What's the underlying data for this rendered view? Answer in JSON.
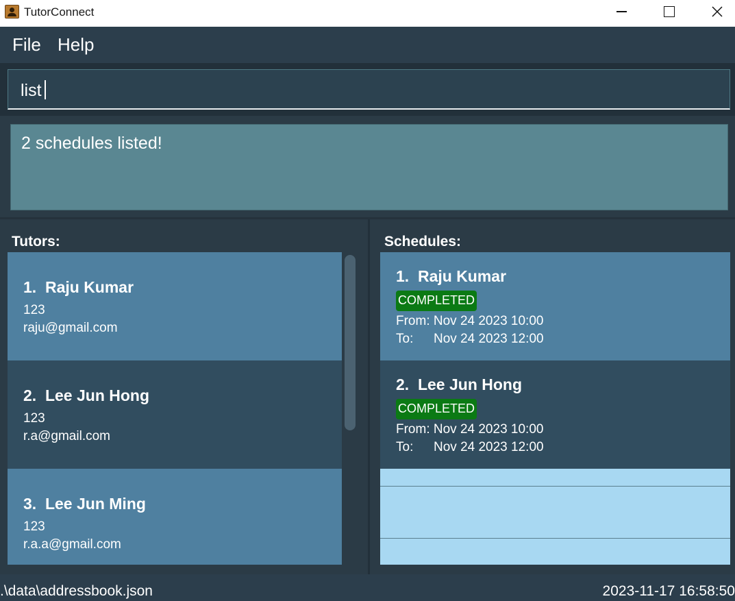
{
  "window": {
    "title": "TutorConnect",
    "icon": "contact-book-icon"
  },
  "menu": {
    "items": [
      "File",
      "Help"
    ]
  },
  "command": {
    "value": "list"
  },
  "result": {
    "message": "2 schedules listed!"
  },
  "tutors": {
    "heading": "Tutors:",
    "items": [
      {
        "index": "1.",
        "name": "Raju Kumar",
        "phone": "123",
        "email": "raju@gmail.com"
      },
      {
        "index": "2.",
        "name": "Lee Jun Hong",
        "phone": "123",
        "email": "r.a@gmail.com"
      },
      {
        "index": "3.",
        "name": "Lee Jun Ming",
        "phone": "123",
        "email": "r.a.a@gmail.com"
      }
    ]
  },
  "schedules": {
    "heading": "Schedules:",
    "items": [
      {
        "index": "1.",
        "name": "Raju Kumar",
        "status": "COMPLETED",
        "from_label": "From:",
        "from": "Nov 24 2023 10:00",
        "to_label": "To:",
        "to": "Nov 24 2023 12:00"
      },
      {
        "index": "2.",
        "name": "Lee Jun Hong",
        "status": "COMPLETED",
        "from_label": "From:",
        "from": "Nov 24 2023 10:00",
        "to_label": "To:",
        "to": "Nov 24 2023 12:00"
      }
    ]
  },
  "status_bar": {
    "file_path": ".\\data\\addressbook.json",
    "timestamp": "2023-11-17 16:58:50"
  },
  "colors": {
    "card_light": "#4f80a0",
    "card_dark": "#314d5f",
    "badge_completed": "#0b7a14",
    "empty_list": "#a8d8f2"
  }
}
